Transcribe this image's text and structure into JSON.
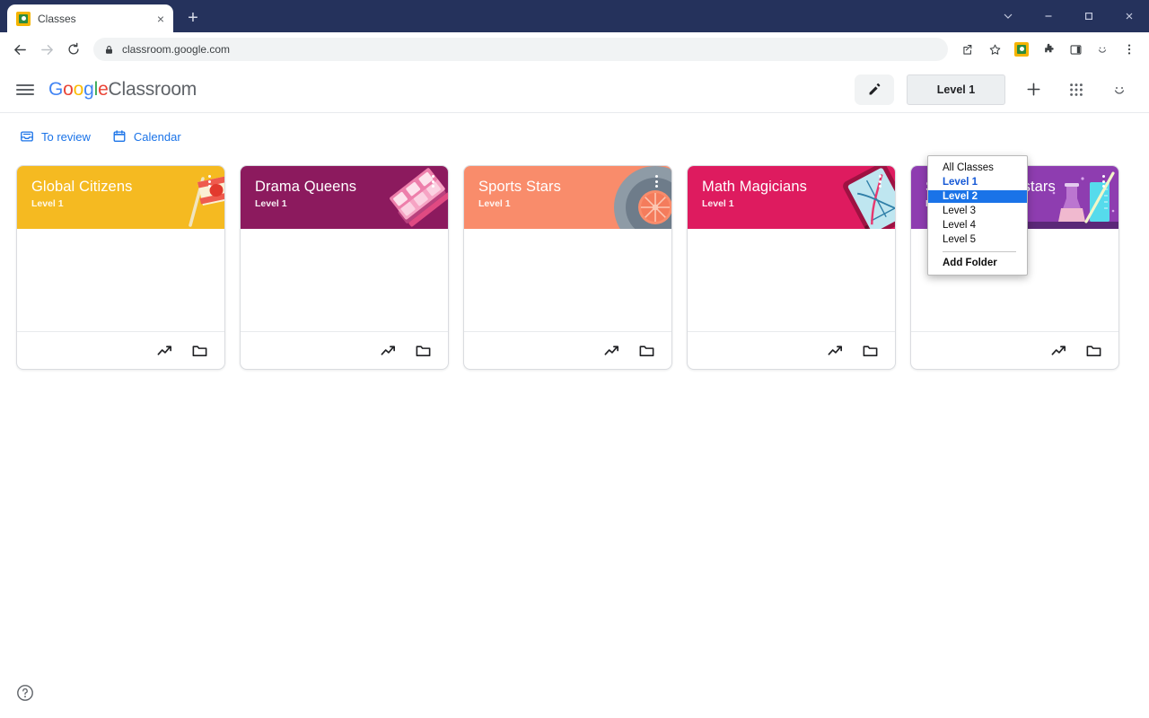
{
  "browser": {
    "tab": {
      "title": "Classes",
      "favicon": "classroom-favicon",
      "close": "×"
    },
    "new_tab_label": "+",
    "window_controls": [
      {
        "name": "chevron-down",
        "glyph": "∨"
      },
      {
        "name": "minimize",
        "glyph": "–"
      },
      {
        "name": "maximize",
        "glyph": "□"
      },
      {
        "name": "close",
        "glyph": "✕"
      }
    ],
    "nav": {
      "back": "←",
      "forward": "→",
      "reload": "⟳"
    },
    "omnibox": {
      "url": "classroom.google.com",
      "lock": "lock-icon"
    },
    "toolbar_right": [
      "share-icon",
      "bookmark-star-icon",
      "classroom-extension-icon",
      "extensions-puzzle-icon",
      "side-panel-icon",
      "profile-smiley-icon",
      "chrome-menu-icon"
    ]
  },
  "app": {
    "brand": {
      "g": "G",
      "o1": "o",
      "o2": "o",
      "g2": "g",
      "l": "l",
      "e": "e",
      "product": "Classroom"
    },
    "menu_label": "Main menu",
    "edit_button": "edit-pencil",
    "level_button": "Level 1",
    "add_button": "+",
    "apps_button": "apps-grid",
    "account_button": "account-smiley"
  },
  "dropdown": {
    "open": true,
    "items": [
      {
        "label": "All Classes",
        "state": "normal"
      },
      {
        "label": "Level 1",
        "state": "link"
      },
      {
        "label": "Level 2",
        "state": "selected"
      },
      {
        "label": "Level 3",
        "state": "normal"
      },
      {
        "label": "Level 4",
        "state": "normal"
      },
      {
        "label": "Level 5",
        "state": "normal"
      }
    ],
    "footer_item": "Add Folder",
    "selected_color": "#1a73e8",
    "link_color": "#1558d6"
  },
  "nav": {
    "items": [
      {
        "label": "To review",
        "icon": "to-review-tray-icon"
      },
      {
        "label": "Calendar",
        "icon": "calendar-icon"
      }
    ]
  },
  "classes": [
    {
      "title": "Global Citizens",
      "level": "Level 1",
      "color": "#F5BA21",
      "art": "flag-illustration"
    },
    {
      "title": "Drama Queens",
      "level": "Level 1",
      "color": "#8C1A5E",
      "art": "theater-tickets-illustration"
    },
    {
      "title": "Sports Stars",
      "level": "Level 1",
      "color": "#F98C6B",
      "art": "sports-ball-illustration"
    },
    {
      "title": "Math Magicians",
      "level": "Level 1",
      "color": "#DE1B5F",
      "art": "tablet-graph-illustration"
    },
    {
      "title": "Science Superstars",
      "level": "Level 1",
      "color": "#8E3DB0",
      "art": "beakers-illustration"
    }
  ],
  "card_footer": {
    "progress_icon": "trending-up-icon",
    "folder_icon": "folder-icon"
  },
  "help": {
    "label": "help-icon"
  }
}
